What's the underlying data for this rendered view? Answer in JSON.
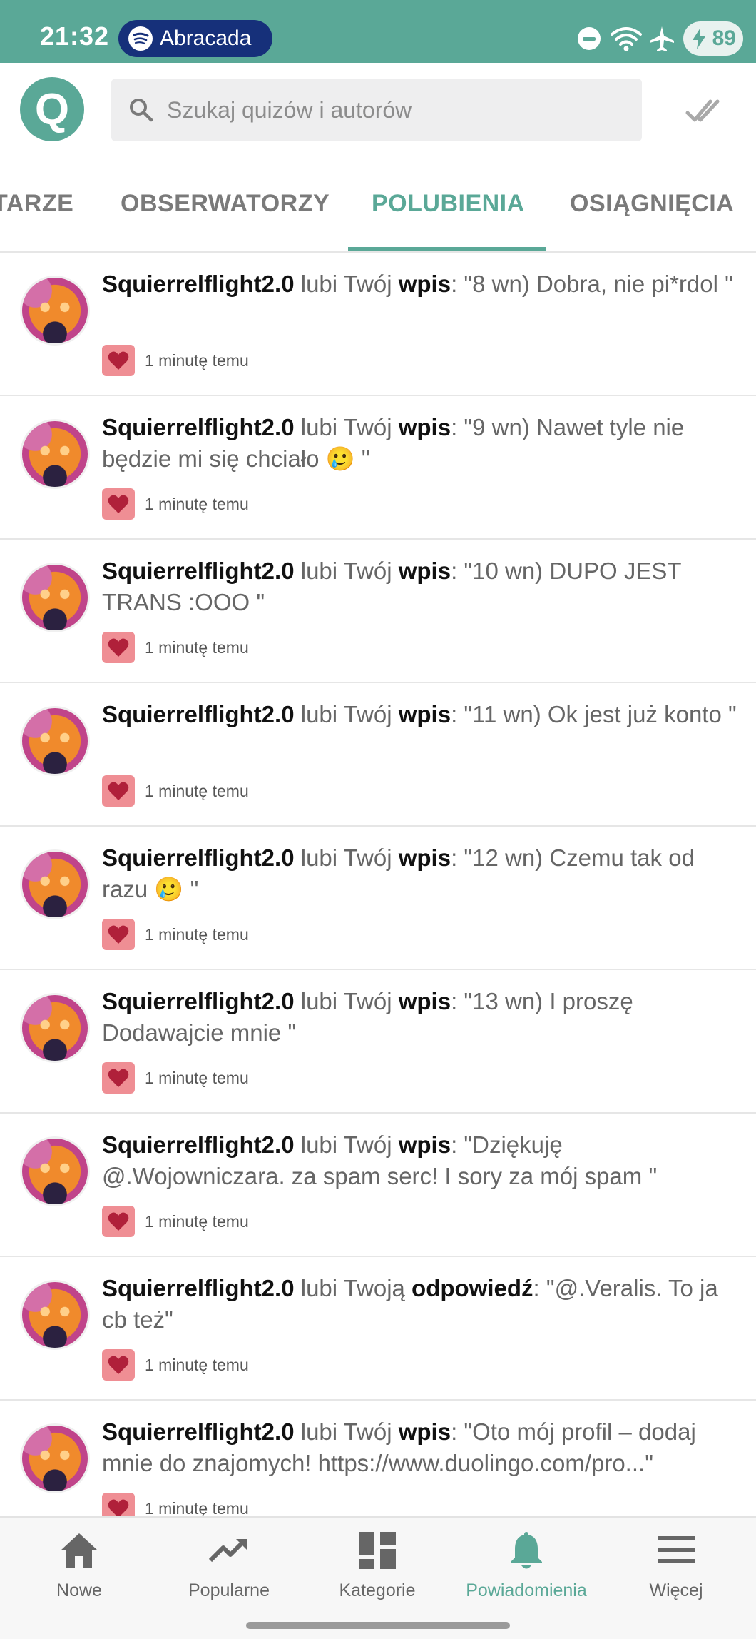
{
  "status_bar": {
    "time": "21:32",
    "media_app": "Abracada",
    "battery": "89",
    "icons": [
      "spotify-icon",
      "do-not-disturb-icon",
      "wifi-icon",
      "airplane-icon",
      "battery-charging-icon"
    ]
  },
  "header": {
    "logo_letter": "Q",
    "search_placeholder": "Szukaj quizów i autorów",
    "mark_read_icon": "double-check-icon"
  },
  "tabs": [
    {
      "label": "TARZE",
      "active": false
    },
    {
      "label": "OBSERWATORZY",
      "active": false
    },
    {
      "label": "POLUBIENIA",
      "active": true
    },
    {
      "label": "OSIĄGNIĘCIA",
      "active": false
    }
  ],
  "notifications": [
    {
      "user": "Squierrelflight2.0",
      "verb": " lubi Twój ",
      "kind": "wpis",
      "text": ": \"8 wn) Dobra, nie pi*rdol \"",
      "time": "1 minutę temu"
    },
    {
      "user": "Squierrelflight2.0",
      "verb": " lubi Twój ",
      "kind": "wpis",
      "text": ": \"9 wn) Nawet tyle nie będzie mi się chciało 🥲 \"",
      "time": "1 minutę temu"
    },
    {
      "user": "Squierrelflight2.0",
      "verb": " lubi Twój ",
      "kind": "wpis",
      "text": ": \"10 wn) DUPO JEST TRANS :OOO \"",
      "time": "1 minutę temu"
    },
    {
      "user": "Squierrelflight2.0",
      "verb": " lubi Twój ",
      "kind": "wpis",
      "text": ": \"11 wn) Ok jest już konto \"",
      "time": "1 minutę temu"
    },
    {
      "user": "Squierrelflight2.0",
      "verb": " lubi Twój ",
      "kind": "wpis",
      "text": ": \"12 wn) Czemu tak od razu 🥲 \"",
      "time": "1 minutę temu"
    },
    {
      "user": "Squierrelflight2.0",
      "verb": " lubi Twój ",
      "kind": "wpis",
      "text": ": \"13 wn) I proszę Dodawajcie mnie \"",
      "time": "1 minutę temu"
    },
    {
      "user": "Squierrelflight2.0",
      "verb": " lubi Twój ",
      "kind": "wpis",
      "text": ": \"Dziękuję @.Wojowniczara. za spam serc! I sory za mój spam \"",
      "time": "1 minutę temu"
    },
    {
      "user": "Squierrelflight2.0",
      "verb": " lubi Twoją ",
      "kind": "odpowiedź",
      "text": ": \"@.Veralis. To ja cb też\"",
      "time": "1 minutę temu"
    },
    {
      "user": "Squierrelflight2.0",
      "verb": " lubi Twój ",
      "kind": "wpis",
      "text": ": \"Oto mój profil – dodaj mnie do znajomych! https://www.duolingo.com/pro...\"",
      "time": "1 minutę temu"
    }
  ],
  "bottom_nav": [
    {
      "label": "Nowe",
      "icon": "home-icon",
      "active": false
    },
    {
      "label": "Popularne",
      "icon": "trending-icon",
      "active": false
    },
    {
      "label": "Kategorie",
      "icon": "categories-icon",
      "active": false
    },
    {
      "label": "Powiadomienia",
      "icon": "bell-icon",
      "active": true
    },
    {
      "label": "Więcej",
      "icon": "menu-icon",
      "active": false
    }
  ],
  "colors": {
    "accent": "#5aa897",
    "status_bar": "#5aa897",
    "heart_badge": "#ef8e94",
    "heart": "#b0203a",
    "spotify_pill": "#16307a"
  }
}
